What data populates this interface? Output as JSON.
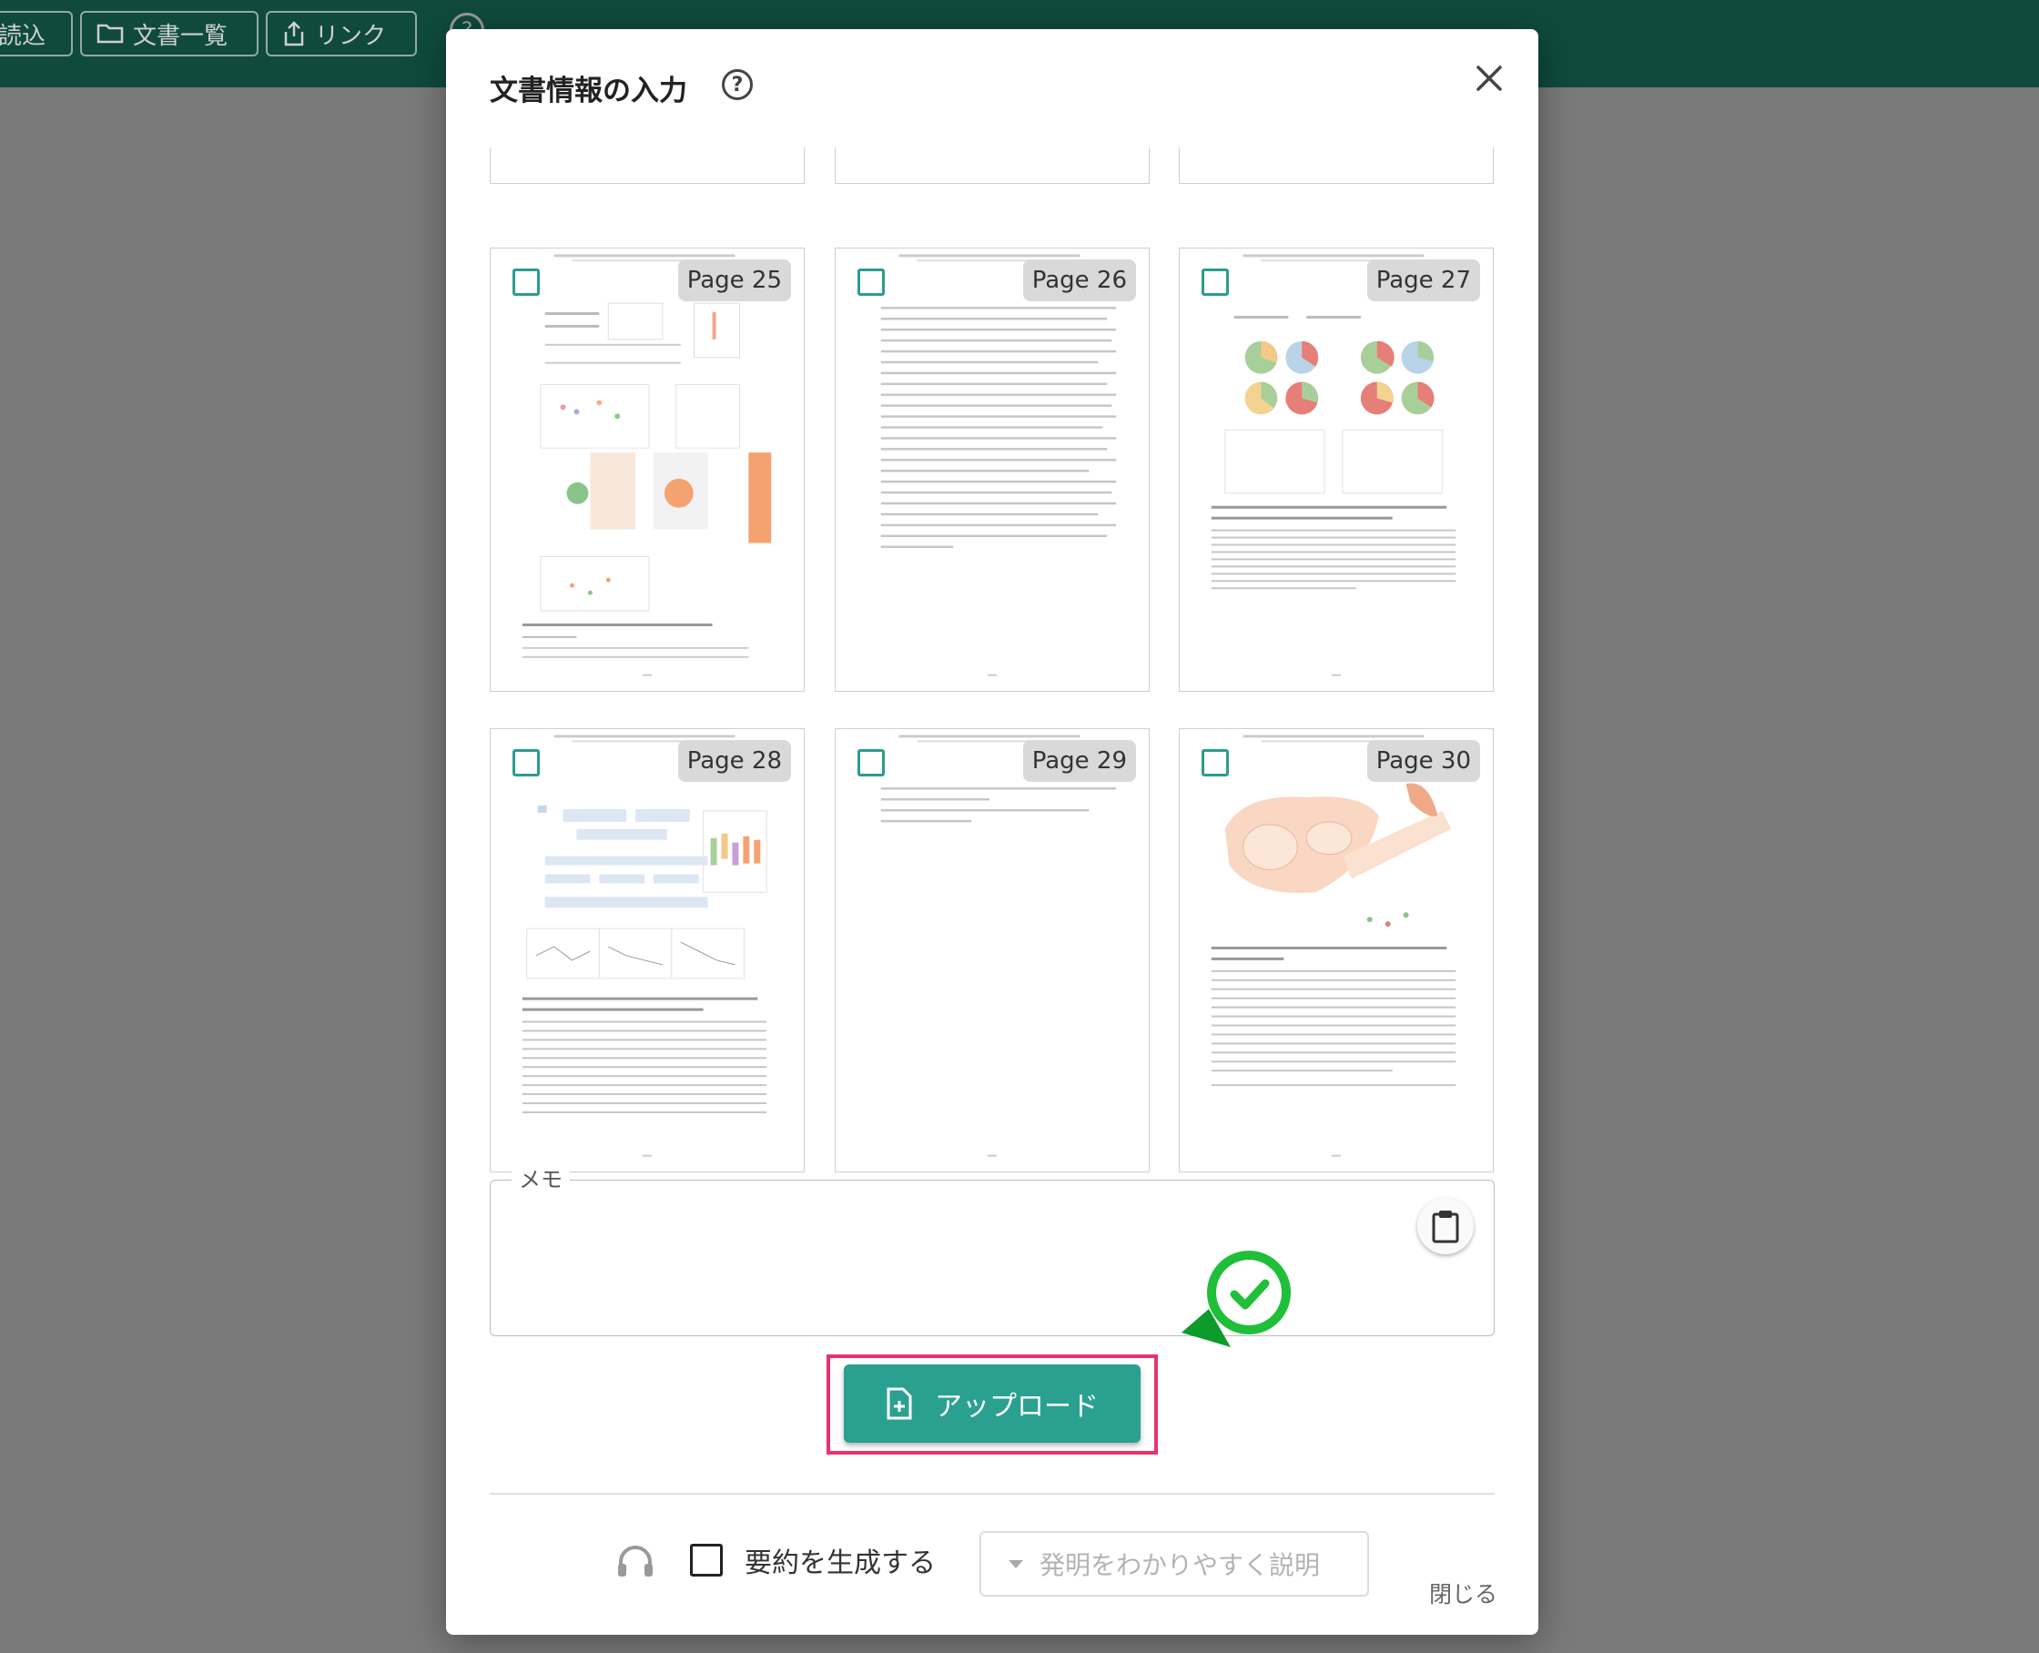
{
  "topbar": {
    "buttons": [
      {
        "label": "読込",
        "icon": "upload-icon"
      },
      {
        "label": "文書一覧",
        "icon": "folder-icon"
      },
      {
        "label": "リンク",
        "icon": "share-icon"
      }
    ],
    "help_symbol": "?"
  },
  "dialog": {
    "title": "文書情報の入力",
    "help_symbol": "?",
    "close_icon": "close-icon"
  },
  "pages": [
    {
      "label": "Page 25",
      "checked": false
    },
    {
      "label": "Page 26",
      "checked": false
    },
    {
      "label": "Page 27",
      "checked": false
    },
    {
      "label": "Page 28",
      "checked": false
    },
    {
      "label": "Page 29",
      "checked": false
    },
    {
      "label": "Page 30",
      "checked": false
    }
  ],
  "memo": {
    "label": "メモ",
    "value": "",
    "paste_icon": "clipboard-icon"
  },
  "upload": {
    "label": "アップロード",
    "icon": "file-plus-icon"
  },
  "footer": {
    "summary_label": "要約を生成する",
    "summary_checked": false,
    "select_placeholder": "発明をわかりやすく説明",
    "close_label": "閉じる"
  },
  "colors": {
    "accent": "#2aa090",
    "checkbox": "#2a9d8f",
    "highlight": "#e8336d",
    "success": "#1fbf3a",
    "topbar": "#0f4a3d",
    "overlay": "#7a7a7a"
  }
}
